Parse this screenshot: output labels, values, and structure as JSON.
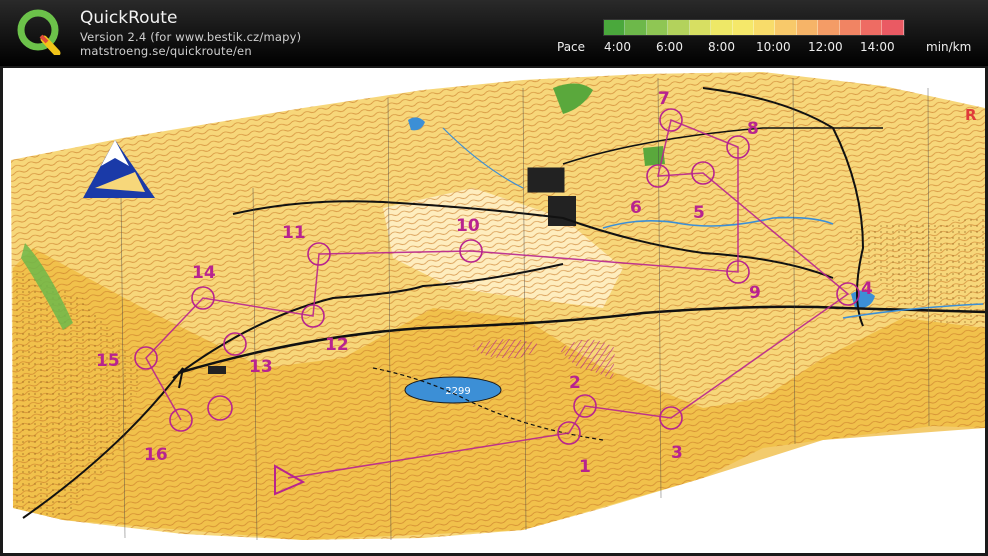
{
  "app": {
    "title": "QuickRoute",
    "version_line": "Version 2.4  (for www.bestik.cz/mapy)",
    "url_line": "matstroeng.se/quickroute/en",
    "logo_icon": "quickroute-q-logo-icon"
  },
  "pace_legend": {
    "label": "Pace",
    "ticks": [
      "4:00",
      "6:00",
      "8:00",
      "10:00",
      "12:00",
      "14:00"
    ],
    "unit": "min/km",
    "colors": [
      "#4aa83c",
      "#6db84a",
      "#8fc654",
      "#b3d25c",
      "#d7df62",
      "#eee867",
      "#f5e86a",
      "#f8dc6a",
      "#f8c96a",
      "#f6b468",
      "#f49c66",
      "#f18463",
      "#ee6c63",
      "#ea5a63"
    ]
  },
  "map": {
    "lake_label": "2299",
    "edge_letter": "R",
    "controls": [
      {
        "num": "1"
      },
      {
        "num": "2"
      },
      {
        "num": "3"
      },
      {
        "num": "4"
      },
      {
        "num": "5"
      },
      {
        "num": "6"
      },
      {
        "num": "7"
      },
      {
        "num": "8"
      },
      {
        "num": "9"
      },
      {
        "num": "10"
      },
      {
        "num": "11"
      },
      {
        "num": "12"
      },
      {
        "num": "13"
      },
      {
        "num": "14"
      },
      {
        "num": "15"
      },
      {
        "num": "16"
      }
    ],
    "colors": {
      "terrain_open": "#f7d77a",
      "terrain_rough": "#efb93c",
      "contour": "#c97a2a",
      "course": "#b8238f",
      "forest": "#5aa83c",
      "water": "#3c8fd6",
      "track": "#111111"
    }
  }
}
